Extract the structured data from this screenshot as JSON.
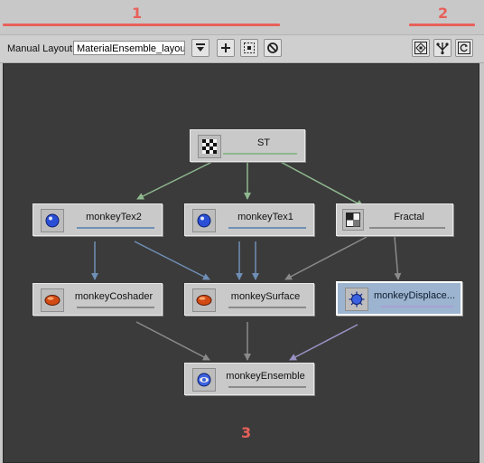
{
  "annotations": {
    "a1": "1",
    "a2": "2",
    "a3": "3"
  },
  "toolbar": {
    "label": "Manual Layout",
    "layout_select_value": "MaterialEnsemble_layout"
  },
  "nodes": {
    "st": {
      "label": "ST"
    },
    "monkeytex2": {
      "label": "monkeyTex2"
    },
    "monkeytex1": {
      "label": "monkeyTex1"
    },
    "fractal": {
      "label": "Fractal"
    },
    "coshader": {
      "label": "monkeyCoshader"
    },
    "surface": {
      "label": "monkeySurface"
    },
    "displace": {
      "label": "monkeyDisplace..."
    },
    "ensemble": {
      "label": "monkeyEnsemble"
    }
  },
  "colors": {
    "annotation": "#e8605a",
    "edge_st": "#8fb88f",
    "edge_tex": "#6f8fb5",
    "edge_gray": "#8a8a8a",
    "edge_displace": "#9a92c4",
    "bar_green": "#8fb88f",
    "bar_blue": "#6f8fb5",
    "bar_gray": "#8a8a8a",
    "bar_lavender": "#a7a0d6"
  },
  "icons": {
    "dropdown": "dropdown-arrow-icon",
    "add": "plus-icon",
    "select_all": "frame-select-icon",
    "clear": "no-entry-icon",
    "frame_nodes": "frame-nodes-icon",
    "layout_tree": "layout-tree-icon",
    "refresh": "refresh-icon"
  }
}
